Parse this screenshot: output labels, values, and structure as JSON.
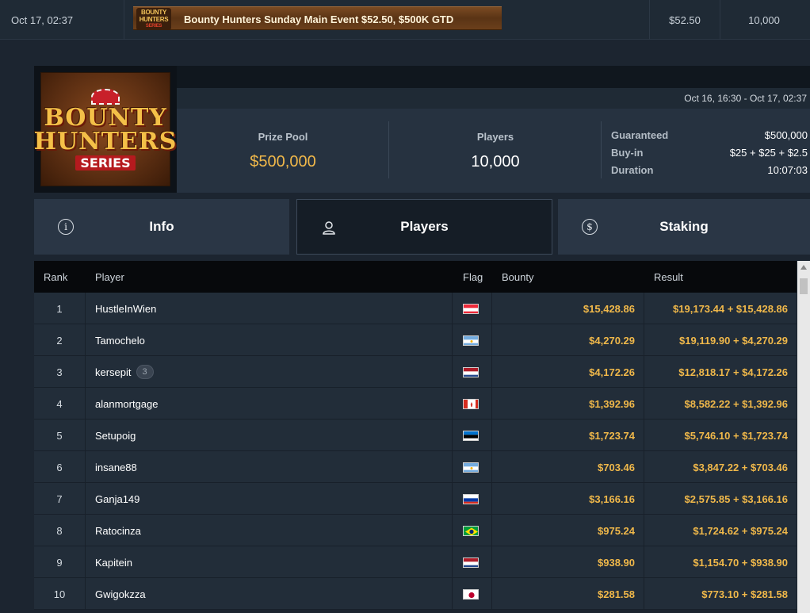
{
  "top_row": {
    "datetime": "Oct 17, 02:37",
    "banner_logo_line1": "BOUNTY",
    "banner_logo_line2": "HUNTERS",
    "banner_logo_line3": "SERIES",
    "tournament_name": "Bounty Hunters Sunday Main Event $52.50, $500K GTD",
    "buyin": "$52.50",
    "entries": "10,000"
  },
  "tournament": {
    "logo_line1": "BOUNTY",
    "logo_line2": "HUNTERS",
    "logo_line3": "SERIES",
    "date_range": "Oct 16, 16:30 - Oct 17, 02:37",
    "prize_pool_label": "Prize Pool",
    "prize_pool_value": "$500,000",
    "players_label": "Players",
    "players_value": "10,000",
    "details": [
      {
        "key": "Guaranteed",
        "value": "$500,000"
      },
      {
        "key": "Buy-in",
        "value": "$25 + $25 + $2.5"
      },
      {
        "key": "Duration",
        "value": "10:07:03"
      }
    ]
  },
  "tabs": [
    {
      "label": "Info",
      "icon": "info-icon",
      "active": false
    },
    {
      "label": "Players",
      "icon": "user-icon",
      "active": true
    },
    {
      "label": "Staking",
      "icon": "dollar-icon",
      "active": false
    }
  ],
  "table": {
    "headers": {
      "rank": "Rank",
      "player": "Player",
      "flag": "Flag",
      "bounty": "Bounty",
      "result": "Result"
    },
    "rows": [
      {
        "rank": "1",
        "player": "HustleInWien",
        "badge": "",
        "flag": "austria",
        "bounty": "$15,428.86",
        "result": "$19,173.44 + $15,428.86"
      },
      {
        "rank": "2",
        "player": "Tamochelo",
        "badge": "",
        "flag": "argentina",
        "bounty": "$4,270.29",
        "result": "$19,119.90 + $4,270.29"
      },
      {
        "rank": "3",
        "player": "kersepit",
        "badge": "3",
        "flag": "netherlands",
        "bounty": "$4,172.26",
        "result": "$12,818.17 + $4,172.26"
      },
      {
        "rank": "4",
        "player": "alanmortgage",
        "badge": "",
        "flag": "canada",
        "bounty": "$1,392.96",
        "result": "$8,582.22 + $1,392.96"
      },
      {
        "rank": "5",
        "player": "Setupoig",
        "badge": "",
        "flag": "estonia",
        "bounty": "$1,723.74",
        "result": "$5,746.10 + $1,723.74"
      },
      {
        "rank": "6",
        "player": "insane88",
        "badge": "",
        "flag": "argentina",
        "bounty": "$703.46",
        "result": "$3,847.22 + $703.46"
      },
      {
        "rank": "7",
        "player": "Ganja149",
        "badge": "",
        "flag": "russia",
        "bounty": "$3,166.16",
        "result": "$2,575.85 + $3,166.16"
      },
      {
        "rank": "8",
        "player": "Ratocinza",
        "badge": "",
        "flag": "brazil",
        "bounty": "$975.24",
        "result": "$1,724.62 + $975.24"
      },
      {
        "rank": "9",
        "player": "Kapitein",
        "badge": "",
        "flag": "netherlands",
        "bounty": "$938.90",
        "result": "$1,154.70 + $938.90"
      },
      {
        "rank": "10",
        "player": "Gwigokzza",
        "badge": "",
        "flag": "japan",
        "bounty": "$281.58",
        "result": "$773.10 + $281.58"
      }
    ]
  },
  "colors": {
    "accent_gold": "#f0b84a",
    "background": "#1c2530",
    "row": "#222d39"
  }
}
